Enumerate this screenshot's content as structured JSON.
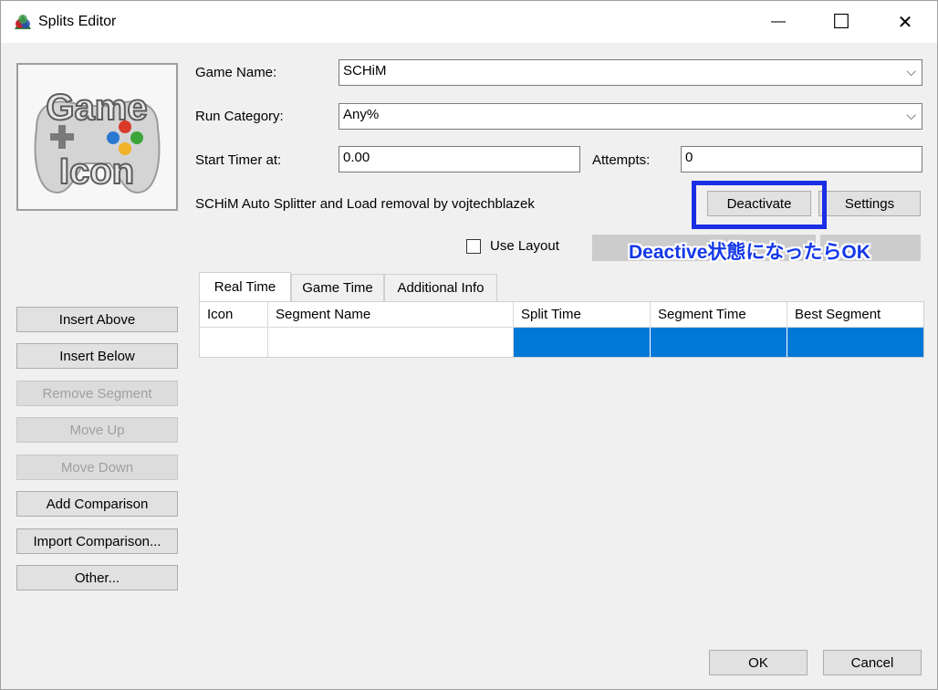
{
  "window": {
    "title": "Splits Editor"
  },
  "titlebar": {
    "minimize_glyph": "—",
    "maximize_glyph": "☐",
    "close_glyph": "✕"
  },
  "game_icon": {
    "line1": "Game",
    "line2": "Icon"
  },
  "form": {
    "game_name_label": "Game Name:",
    "game_name_value": "SCHiM",
    "run_category_label": "Run Category:",
    "run_category_value": "Any%",
    "start_timer_label": "Start Timer at:",
    "start_timer_value": "0.00",
    "attempts_label": "Attempts:",
    "attempts_value": "0",
    "autosplitter_text": "SCHiM Auto Splitter and Load removal by vojtechblazek",
    "deactivate_label": "Deactivate",
    "settings_label": "Settings",
    "use_layout_label": "Use Layout"
  },
  "annotation": {
    "text": "Deactive状態になったらOK",
    "color": "#1438e8"
  },
  "side_buttons": {
    "insert_above": "Insert Above",
    "insert_below": "Insert Below",
    "remove_segment": "Remove Segment",
    "move_up": "Move Up",
    "move_down": "Move Down",
    "add_comparison": "Add Comparison",
    "import_comparison": "Import Comparison...",
    "other": "Other..."
  },
  "tabs": {
    "real_time": "Real Time",
    "game_time": "Game Time",
    "additional_info": "Additional Info"
  },
  "grid": {
    "columns": [
      "Icon",
      "Segment Name",
      "Split Time",
      "Segment Time",
      "Best Segment"
    ]
  },
  "footer": {
    "ok_label": "OK",
    "cancel_label": "Cancel"
  },
  "colors": {
    "selection": "#0078d7",
    "annotation_border": "#1a2ee6"
  }
}
